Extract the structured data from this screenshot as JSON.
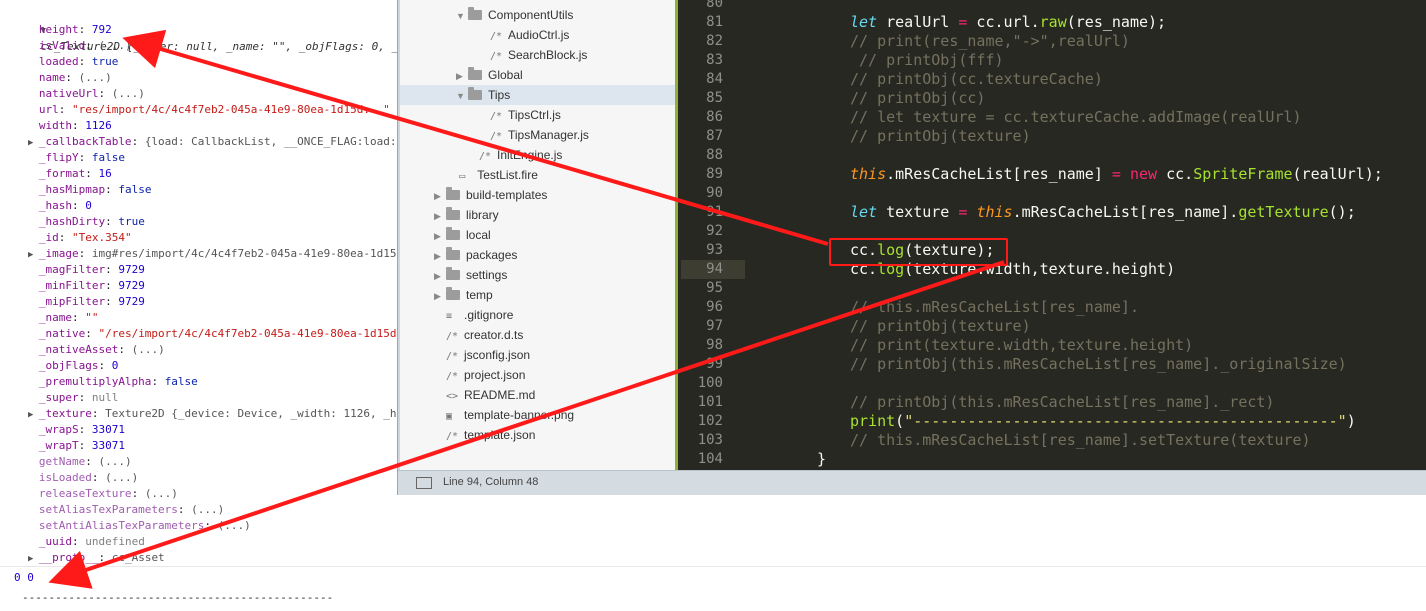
{
  "console": {
    "header": {
      "arrow": "▼",
      "text": "cc_Texture2D {_super: null, _name: \"\", _objFlags: 0, _na"
    },
    "rows": [
      {
        "key": "height",
        "sep": ": ",
        "val": "792",
        "cls": "cnum",
        "expander": false,
        "inherited": false
      },
      {
        "key": "isValid",
        "sep": ": ",
        "val": "(...)",
        "cls": "cdim",
        "expander": false,
        "inherited": false
      },
      {
        "key": "loaded",
        "sep": ": ",
        "val": "true",
        "cls": "cbool",
        "expander": false,
        "inherited": false
      },
      {
        "key": "name",
        "sep": ": ",
        "val": "(...)",
        "cls": "cdim",
        "expander": false,
        "inherited": false
      },
      {
        "key": "nativeUrl",
        "sep": ": ",
        "val": "(...)",
        "cls": "cdim",
        "expander": false,
        "inherited": false
      },
      {
        "key": "url",
        "sep": ": ",
        "val": "\"res/import/4c/4c4f7eb2-045a-41e9-80ea-1d15d...\"",
        "cls": "cstr",
        "expander": false,
        "inherited": false
      },
      {
        "key": "width",
        "sep": ": ",
        "val": "1126",
        "cls": "cnum",
        "expander": false,
        "inherited": false
      },
      {
        "key": "_callbackTable",
        "sep": ": ",
        "val": "{load: CallbackList, __ONCE_FLAG:load:",
        "cls": "cdim",
        "expander": true,
        "inherited": false
      },
      {
        "key": "_flipY",
        "sep": ": ",
        "val": "false",
        "cls": "cbool",
        "expander": false,
        "inherited": false
      },
      {
        "key": "_format",
        "sep": ": ",
        "val": "16",
        "cls": "cnum",
        "expander": false,
        "inherited": false
      },
      {
        "key": "_hasMipmap",
        "sep": ": ",
        "val": "false",
        "cls": "cbool",
        "expander": false,
        "inherited": false
      },
      {
        "key": "_hash",
        "sep": ": ",
        "val": "0",
        "cls": "cnum",
        "expander": false,
        "inherited": false
      },
      {
        "key": "_hashDirty",
        "sep": ": ",
        "val": "true",
        "cls": "cbool",
        "expander": false,
        "inherited": false
      },
      {
        "key": "_id",
        "sep": ": ",
        "val": "\"Tex.354\"",
        "cls": "cstr",
        "expander": false,
        "inherited": false
      },
      {
        "key": "_image",
        "sep": ": ",
        "val": "img#res/import/4c/4c4f7eb2-045a-41e9-80ea-1d15d",
        "cls": "cdim",
        "expander": true,
        "inherited": false
      },
      {
        "key": "_magFilter",
        "sep": ": ",
        "val": "9729",
        "cls": "cnum",
        "expander": false,
        "inherited": false
      },
      {
        "key": "_minFilter",
        "sep": ": ",
        "val": "9729",
        "cls": "cnum",
        "expander": false,
        "inherited": false
      },
      {
        "key": "_mipFilter",
        "sep": ": ",
        "val": "9729",
        "cls": "cnum",
        "expander": false,
        "inherited": false
      },
      {
        "key": "_name",
        "sep": ": ",
        "val": "\"\"",
        "cls": "cstr",
        "expander": false,
        "inherited": false
      },
      {
        "key": "_native",
        "sep": ": ",
        "val": "\"/res/import/4c/4c4f7eb2-045a-41e9-80ea-1d15d",
        "cls": "cstr",
        "expander": false,
        "inherited": false
      },
      {
        "key": "_nativeAsset",
        "sep": ": ",
        "val": "(...)",
        "cls": "cdim",
        "expander": false,
        "inherited": false
      },
      {
        "key": "_objFlags",
        "sep": ": ",
        "val": "0",
        "cls": "cnum",
        "expander": false,
        "inherited": false
      },
      {
        "key": "_premultiplyAlpha",
        "sep": ": ",
        "val": "false",
        "cls": "cbool",
        "expander": false,
        "inherited": false
      },
      {
        "key": "_super",
        "sep": ": ",
        "val": "null",
        "cls": "cnull",
        "expander": false,
        "inherited": false
      },
      {
        "key": "_texture",
        "sep": ": ",
        "val": "Texture2D {_device: Device, _width: 1126, _he",
        "cls": "cdim",
        "expander": true,
        "inherited": false
      },
      {
        "key": "_wrapS",
        "sep": ": ",
        "val": "33071",
        "cls": "cnum",
        "expander": false,
        "inherited": false
      },
      {
        "key": "_wrapT",
        "sep": ": ",
        "val": "33071",
        "cls": "cnum",
        "expander": false,
        "inherited": false
      },
      {
        "key": "getName",
        "sep": ": ",
        "val": "(...)",
        "cls": "cdim",
        "expander": false,
        "inherited": true
      },
      {
        "key": "isLoaded",
        "sep": ": ",
        "val": "(...)",
        "cls": "cdim",
        "expander": false,
        "inherited": true
      },
      {
        "key": "releaseTexture",
        "sep": ": ",
        "val": "(...)",
        "cls": "cdim",
        "expander": false,
        "inherited": true
      },
      {
        "key": "setAliasTexParameters",
        "sep": ": ",
        "val": "(...)",
        "cls": "cdim",
        "expander": false,
        "inherited": true
      },
      {
        "key": "setAntiAliasTexParameters",
        "sep": ": ",
        "val": "(...)",
        "cls": "cdim",
        "expander": false,
        "inherited": true
      },
      {
        "key": "_uuid",
        "sep": ": ",
        "val": "undefined",
        "cls": "cnull",
        "expander": false,
        "inherited": false
      },
      {
        "key": "__proto__",
        "sep": ": ",
        "val": "cc_Asset",
        "cls": "cdim",
        "expander": true,
        "inherited": false
      }
    ],
    "output_line": "0 0",
    "dash_line": "-----------------------------------------------"
  },
  "file_tree": [
    {
      "indent": 1,
      "arrow": "▼",
      "type": "folder",
      "label": "ComponentUtils"
    },
    {
      "indent": 2,
      "arrow": "",
      "type": "js",
      "label": "AudioCtrl.js"
    },
    {
      "indent": 2,
      "arrow": "",
      "type": "js",
      "label": "SearchBlock.js"
    },
    {
      "indent": 1,
      "arrow": "▶",
      "type": "folder",
      "label": "Global"
    },
    {
      "indent": 1,
      "arrow": "▼",
      "type": "folder",
      "label": "Tips",
      "selected": true
    },
    {
      "indent": 2,
      "arrow": "",
      "type": "js",
      "label": "TipsCtrl.js"
    },
    {
      "indent": 2,
      "arrow": "",
      "type": "js",
      "label": "TipsManager.js"
    },
    {
      "indent": 1.5,
      "arrow": "",
      "type": "js",
      "label": "InitEngine.js"
    },
    {
      "indent": 0.6,
      "arrow": "",
      "type": "fire",
      "label": "TestList.fire"
    },
    {
      "indent": 0,
      "arrow": "▶",
      "type": "folder",
      "label": "build-templates"
    },
    {
      "indent": 0,
      "arrow": "▶",
      "type": "folder",
      "label": "library"
    },
    {
      "indent": 0,
      "arrow": "▶",
      "type": "folder",
      "label": "local"
    },
    {
      "indent": 0,
      "arrow": "▶",
      "type": "folder",
      "label": "packages"
    },
    {
      "indent": 0,
      "arrow": "▶",
      "type": "folder",
      "label": "settings"
    },
    {
      "indent": 0,
      "arrow": "▶",
      "type": "folder",
      "label": "temp"
    },
    {
      "indent": 0,
      "arrow": "",
      "type": "text",
      "label": ".gitignore"
    },
    {
      "indent": 0,
      "arrow": "",
      "type": "js",
      "label": "creator.d.ts"
    },
    {
      "indent": 0,
      "arrow": "",
      "type": "js",
      "label": "jsconfig.json"
    },
    {
      "indent": 0,
      "arrow": "",
      "type": "js",
      "label": "project.json"
    },
    {
      "indent": 0,
      "arrow": "",
      "type": "md",
      "label": "README.md"
    },
    {
      "indent": 0,
      "arrow": "",
      "type": "img",
      "label": "template-banner.png"
    },
    {
      "indent": 0,
      "arrow": "",
      "type": "js",
      "label": "template.json"
    }
  ],
  "code": {
    "current_line": 94,
    "lines": [
      {
        "n": 80,
        "tokens": []
      },
      {
        "n": 81,
        "tokens": [
          [
            "kw",
            "let"
          ],
          [
            "t",
            " realUrl "
          ],
          [
            "kw2",
            "="
          ],
          [
            "t",
            " cc.url."
          ],
          [
            "fn",
            "raw"
          ],
          [
            "t",
            "(res_name);"
          ]
        ]
      },
      {
        "n": 82,
        "tokens": [
          [
            "cm",
            "// print(res_name,\"->\",realUrl)"
          ]
        ]
      },
      {
        "n": 83,
        "tokens": [
          [
            "cm",
            " // printObj(fff)"
          ]
        ]
      },
      {
        "n": 84,
        "tokens": [
          [
            "cm",
            "// printObj(cc.textureCache)"
          ]
        ]
      },
      {
        "n": 85,
        "tokens": [
          [
            "cm",
            "// printObj(cc)"
          ]
        ]
      },
      {
        "n": 86,
        "tokens": [
          [
            "cm",
            "// let texture = cc.textureCache.addImage(realUrl)"
          ]
        ]
      },
      {
        "n": 87,
        "tokens": [
          [
            "cm",
            "// printObj(texture)"
          ]
        ]
      },
      {
        "n": 88,
        "tokens": []
      },
      {
        "n": 89,
        "tokens": [
          [
            "this",
            "this"
          ],
          [
            "t",
            ".mResCacheList[res_name] "
          ],
          [
            "kw2",
            "="
          ],
          [
            "t",
            " "
          ],
          [
            "kw2",
            "new"
          ],
          [
            "t",
            " cc."
          ],
          [
            "fn",
            "SpriteFrame"
          ],
          [
            "t",
            "(realUrl);"
          ]
        ]
      },
      {
        "n": 90,
        "tokens": []
      },
      {
        "n": 91,
        "tokens": [
          [
            "kw",
            "let"
          ],
          [
            "t",
            " texture "
          ],
          [
            "kw2",
            "="
          ],
          [
            "t",
            " "
          ],
          [
            "this",
            "this"
          ],
          [
            "t",
            ".mResCacheList[res_name]."
          ],
          [
            "fn",
            "getTexture"
          ],
          [
            "t",
            "();"
          ]
        ]
      },
      {
        "n": 92,
        "tokens": []
      },
      {
        "n": 93,
        "tokens": [
          [
            "t",
            "cc."
          ],
          [
            "fn",
            "log"
          ],
          [
            "t",
            "(texture);"
          ]
        ]
      },
      {
        "n": 94,
        "tokens": [
          [
            "t",
            "cc."
          ],
          [
            "fn",
            "log"
          ],
          [
            "t",
            "(texture.width,texture.height)"
          ]
        ]
      },
      {
        "n": 95,
        "tokens": []
      },
      {
        "n": 96,
        "tokens": [
          [
            "cm",
            "// this.mResCacheList[res_name]."
          ]
        ]
      },
      {
        "n": 97,
        "tokens": [
          [
            "cm",
            "// printObj(texture)"
          ]
        ]
      },
      {
        "n": 98,
        "tokens": [
          [
            "cm",
            "// print(texture.width,texture.height)"
          ]
        ]
      },
      {
        "n": 99,
        "tokens": [
          [
            "cm",
            "// printObj(this.mResCacheList[res_name]._originalSize)"
          ]
        ]
      },
      {
        "n": 100,
        "tokens": []
      },
      {
        "n": 101,
        "tokens": [
          [
            "cm",
            "// printObj(this.mResCacheList[res_name]._rect)"
          ]
        ]
      },
      {
        "n": 102,
        "tokens": [
          [
            "fn",
            "print"
          ],
          [
            "t",
            "("
          ],
          [
            "str",
            "\"-----------------------------------------------\""
          ],
          [
            "t",
            ")"
          ]
        ]
      },
      {
        "n": 103,
        "tokens": [
          [
            "cm",
            "// this.mResCacheList[res_name].setTexture(texture)"
          ]
        ]
      },
      {
        "n": 104,
        "tokens": [
          [
            "t",
            "}"
          ]
        ]
      }
    ]
  },
  "statusbar": {
    "text": "Line 94, Column 48"
  },
  "colors": {
    "annotation": "#ff1a1a",
    "editor_bg": "#272822"
  }
}
